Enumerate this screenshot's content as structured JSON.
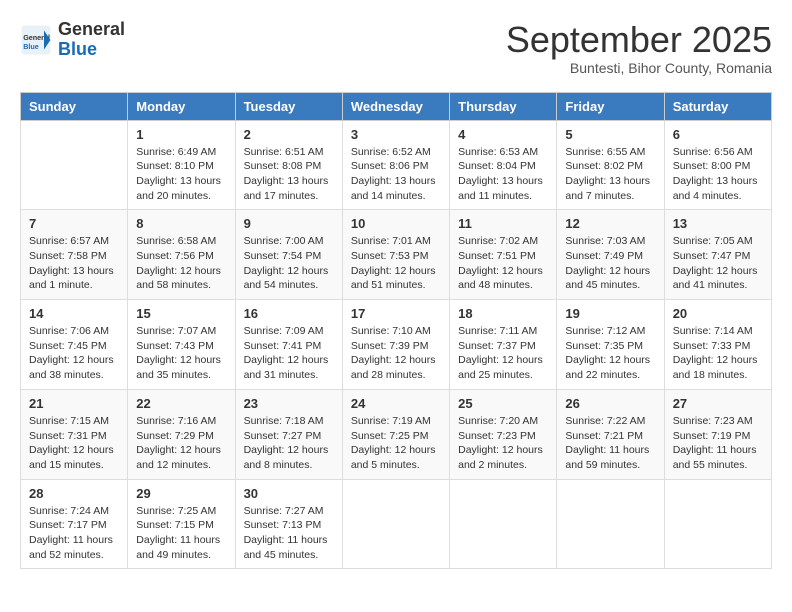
{
  "logo": {
    "general": "General",
    "blue": "Blue"
  },
  "header": {
    "month": "September 2025",
    "location": "Buntesti, Bihor County, Romania"
  },
  "days_of_week": [
    "Sunday",
    "Monday",
    "Tuesday",
    "Wednesday",
    "Thursday",
    "Friday",
    "Saturday"
  ],
  "weeks": [
    [
      {
        "day": "",
        "info": ""
      },
      {
        "day": "1",
        "info": "Sunrise: 6:49 AM\nSunset: 8:10 PM\nDaylight: 13 hours\nand 20 minutes."
      },
      {
        "day": "2",
        "info": "Sunrise: 6:51 AM\nSunset: 8:08 PM\nDaylight: 13 hours\nand 17 minutes."
      },
      {
        "day": "3",
        "info": "Sunrise: 6:52 AM\nSunset: 8:06 PM\nDaylight: 13 hours\nand 14 minutes."
      },
      {
        "day": "4",
        "info": "Sunrise: 6:53 AM\nSunset: 8:04 PM\nDaylight: 13 hours\nand 11 minutes."
      },
      {
        "day": "5",
        "info": "Sunrise: 6:55 AM\nSunset: 8:02 PM\nDaylight: 13 hours\nand 7 minutes."
      },
      {
        "day": "6",
        "info": "Sunrise: 6:56 AM\nSunset: 8:00 PM\nDaylight: 13 hours\nand 4 minutes."
      }
    ],
    [
      {
        "day": "7",
        "info": "Sunrise: 6:57 AM\nSunset: 7:58 PM\nDaylight: 13 hours\nand 1 minute."
      },
      {
        "day": "8",
        "info": "Sunrise: 6:58 AM\nSunset: 7:56 PM\nDaylight: 12 hours\nand 58 minutes."
      },
      {
        "day": "9",
        "info": "Sunrise: 7:00 AM\nSunset: 7:54 PM\nDaylight: 12 hours\nand 54 minutes."
      },
      {
        "day": "10",
        "info": "Sunrise: 7:01 AM\nSunset: 7:53 PM\nDaylight: 12 hours\nand 51 minutes."
      },
      {
        "day": "11",
        "info": "Sunrise: 7:02 AM\nSunset: 7:51 PM\nDaylight: 12 hours\nand 48 minutes."
      },
      {
        "day": "12",
        "info": "Sunrise: 7:03 AM\nSunset: 7:49 PM\nDaylight: 12 hours\nand 45 minutes."
      },
      {
        "day": "13",
        "info": "Sunrise: 7:05 AM\nSunset: 7:47 PM\nDaylight: 12 hours\nand 41 minutes."
      }
    ],
    [
      {
        "day": "14",
        "info": "Sunrise: 7:06 AM\nSunset: 7:45 PM\nDaylight: 12 hours\nand 38 minutes."
      },
      {
        "day": "15",
        "info": "Sunrise: 7:07 AM\nSunset: 7:43 PM\nDaylight: 12 hours\nand 35 minutes."
      },
      {
        "day": "16",
        "info": "Sunrise: 7:09 AM\nSunset: 7:41 PM\nDaylight: 12 hours\nand 31 minutes."
      },
      {
        "day": "17",
        "info": "Sunrise: 7:10 AM\nSunset: 7:39 PM\nDaylight: 12 hours\nand 28 minutes."
      },
      {
        "day": "18",
        "info": "Sunrise: 7:11 AM\nSunset: 7:37 PM\nDaylight: 12 hours\nand 25 minutes."
      },
      {
        "day": "19",
        "info": "Sunrise: 7:12 AM\nSunset: 7:35 PM\nDaylight: 12 hours\nand 22 minutes."
      },
      {
        "day": "20",
        "info": "Sunrise: 7:14 AM\nSunset: 7:33 PM\nDaylight: 12 hours\nand 18 minutes."
      }
    ],
    [
      {
        "day": "21",
        "info": "Sunrise: 7:15 AM\nSunset: 7:31 PM\nDaylight: 12 hours\nand 15 minutes."
      },
      {
        "day": "22",
        "info": "Sunrise: 7:16 AM\nSunset: 7:29 PM\nDaylight: 12 hours\nand 12 minutes."
      },
      {
        "day": "23",
        "info": "Sunrise: 7:18 AM\nSunset: 7:27 PM\nDaylight: 12 hours\nand 8 minutes."
      },
      {
        "day": "24",
        "info": "Sunrise: 7:19 AM\nSunset: 7:25 PM\nDaylight: 12 hours\nand 5 minutes."
      },
      {
        "day": "25",
        "info": "Sunrise: 7:20 AM\nSunset: 7:23 PM\nDaylight: 12 hours\nand 2 minutes."
      },
      {
        "day": "26",
        "info": "Sunrise: 7:22 AM\nSunset: 7:21 PM\nDaylight: 11 hours\nand 59 minutes."
      },
      {
        "day": "27",
        "info": "Sunrise: 7:23 AM\nSunset: 7:19 PM\nDaylight: 11 hours\nand 55 minutes."
      }
    ],
    [
      {
        "day": "28",
        "info": "Sunrise: 7:24 AM\nSunset: 7:17 PM\nDaylight: 11 hours\nand 52 minutes."
      },
      {
        "day": "29",
        "info": "Sunrise: 7:25 AM\nSunset: 7:15 PM\nDaylight: 11 hours\nand 49 minutes."
      },
      {
        "day": "30",
        "info": "Sunrise: 7:27 AM\nSunset: 7:13 PM\nDaylight: 11 hours\nand 45 minutes."
      },
      {
        "day": "",
        "info": ""
      },
      {
        "day": "",
        "info": ""
      },
      {
        "day": "",
        "info": ""
      },
      {
        "day": "",
        "info": ""
      }
    ]
  ]
}
